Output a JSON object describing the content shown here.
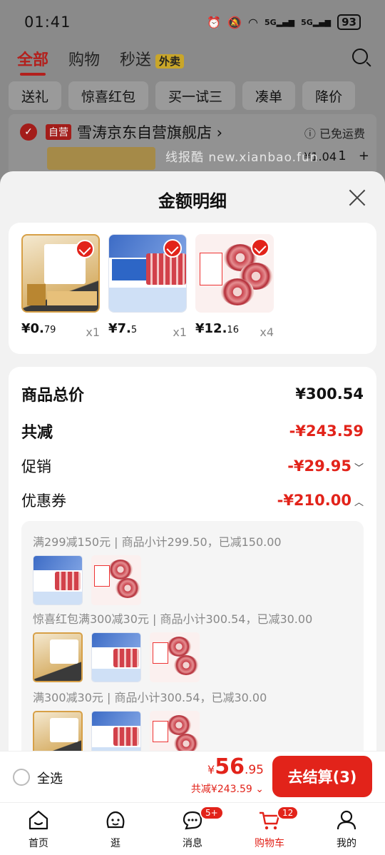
{
  "status_bar": {
    "time": "01:41",
    "battery": "93"
  },
  "top_tabs": {
    "all": "全部",
    "shopping": "购物",
    "instant": "秒送",
    "takeout_badge": "外卖"
  },
  "filters": [
    "送礼",
    "惊喜红包",
    "买一试三",
    "凑单",
    "降价"
  ],
  "store": {
    "self_operated_badge": "自营",
    "name": "雪涛京东自营旗舰店 ›",
    "free_shipping": "ⓘ 已免运费",
    "bg_unit_price": "¥1.04",
    "bg_qty_plus": "+",
    "bg_qty": "1"
  },
  "watermark": "线报酷 new.xianbao.fun",
  "sheet": {
    "title": "金额明细",
    "products": [
      {
        "icon": "salt-product-image",
        "price_main": "¥0.",
        "price_cents": "79",
        "qty": "x1"
      },
      {
        "icon": "beef-roll-product-image",
        "price_main": "¥7.",
        "price_cents": "5",
        "qty": "x1"
      },
      {
        "icon": "lamb-roll-product-image",
        "price_main": "¥12.",
        "price_cents": "16",
        "qty": "x4"
      }
    ],
    "summary": {
      "total_label": "商品总价",
      "total_value": "¥300.54",
      "reduce_label": "共减",
      "reduce_value": "-¥243.59",
      "promo_label": "促销",
      "promo_value": "-¥29.95",
      "coupon_label": "优惠券",
      "coupon_value": "-¥210.00"
    },
    "coupon_lines": [
      "满299减150元 | 商品小计299.50，已减150.00",
      "惊喜红包满300减30元 | 商品小计300.54，已减30.00",
      "满300减30元 | 商品小计300.54，已减30.00"
    ]
  },
  "checkout": {
    "select_all": "全选",
    "currency": "¥",
    "amount_int": "56",
    "amount_dec": ".95",
    "discount_text": "共减¥243.59 ⌄",
    "button": "去结算(3)"
  },
  "tabbar": [
    {
      "label": "首页",
      "icon": "home-icon"
    },
    {
      "label": "逛",
      "icon": "browse-face-icon"
    },
    {
      "label": "消息",
      "icon": "message-icon",
      "badge": "5+"
    },
    {
      "label": "购物车",
      "icon": "cart-icon",
      "badge": "12"
    },
    {
      "label": "我的",
      "icon": "profile-icon"
    }
  ],
  "colors": {
    "accent": "#e2231a",
    "overlay": "#7f7f7f"
  }
}
